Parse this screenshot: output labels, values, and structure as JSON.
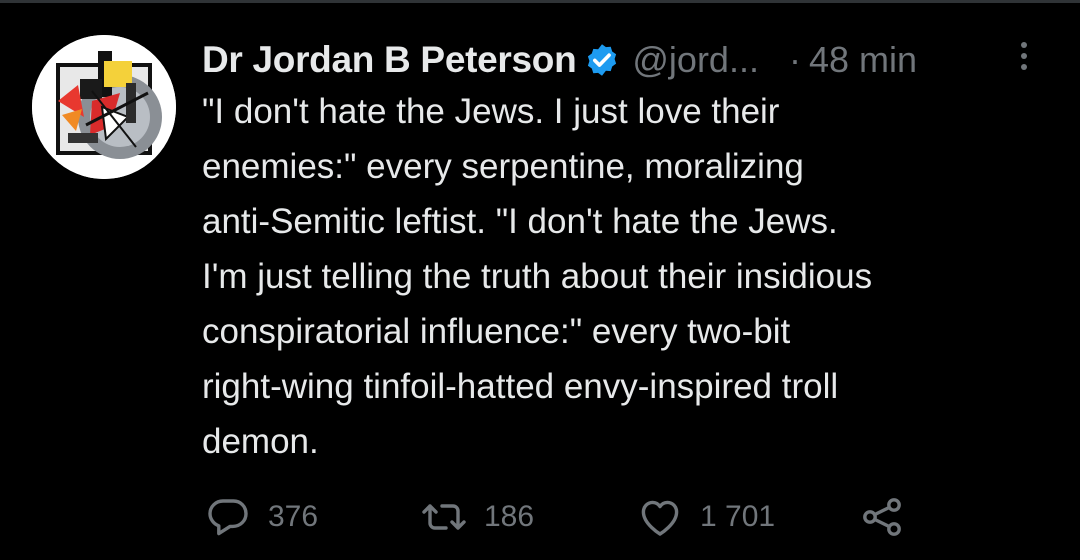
{
  "tweet": {
    "author": {
      "name": "Dr Jordan B Peterson",
      "handle": "@jord...",
      "verified": true,
      "avatar_icon": "abstract-geometric-avatar"
    },
    "separator": "·",
    "timestamp": "48 min",
    "text_lines": [
      "\"I don't hate the Jews. I just love their",
      "enemies:\" every serpentine, moralizing",
      "anti-Semitic leftist. \"I don't hate the Jews.",
      "I'm just telling the truth about their insidious",
      "conspiratorial influence:\" every two-bit",
      "right-wing tinfoil-hatted envy-inspired troll",
      "demon."
    ],
    "actions": {
      "replies": "376",
      "retweets": "186",
      "likes": "1 701"
    }
  },
  "icons": {
    "verified": "verified-badge-icon",
    "more": "more-vertical-icon",
    "reply": "reply-bubble-icon",
    "retweet": "retweet-icon",
    "like": "heart-icon",
    "share": "share-icon"
  },
  "colors": {
    "background": "#000000",
    "text_primary": "#e7e9ea",
    "text_secondary": "#71767b",
    "verified_blue": "#1d9bf0",
    "divider": "#2f3336"
  }
}
